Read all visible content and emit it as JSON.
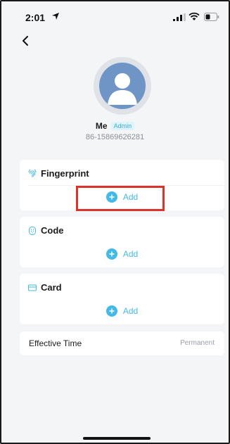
{
  "status_bar": {
    "time": "2:01",
    "icons": [
      "location-arrow-icon",
      "signal-icon",
      "wifi-icon",
      "battery-icon"
    ]
  },
  "nav": {
    "back_icon": "chevron-left-icon"
  },
  "profile": {
    "avatar_icon": "user-avatar-icon",
    "name": "Me",
    "role": "Admin",
    "phone": "86-15869626281"
  },
  "sections": [
    {
      "title": "Fingerprint",
      "icon": "fingerprint-icon",
      "add_label": "Add"
    },
    {
      "title": "Code",
      "icon": "keypad-icon",
      "add_label": "Add"
    },
    {
      "title": "Card",
      "icon": "card-icon",
      "add_label": "Add"
    }
  ],
  "effective_time": {
    "label": "Effective Time",
    "value": "Permanent"
  },
  "colors": {
    "accent": "#45b9e6",
    "highlight": "#d9342b",
    "badge_bg": "#dff3fb",
    "page_bg": "#f4f5f7"
  }
}
